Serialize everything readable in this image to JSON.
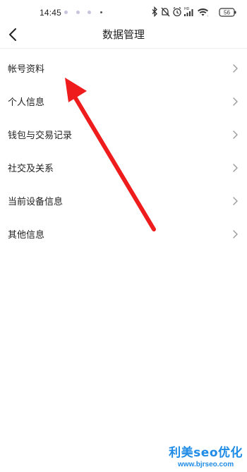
{
  "status_bar": {
    "time": "14:45",
    "battery": "56",
    "icons": [
      "bluetooth-icon",
      "mute-icon",
      "alarm-icon",
      "hd-signal-icon",
      "wifi-icon",
      "battery-icon"
    ]
  },
  "header": {
    "title": "数据管理",
    "back_icon": "chevron-left-icon"
  },
  "menu": {
    "items": [
      {
        "label": "帐号资料"
      },
      {
        "label": "个人信息"
      },
      {
        "label": "钱包与交易记录"
      },
      {
        "label": "社交及关系"
      },
      {
        "label": "当前设备信息"
      },
      {
        "label": "其他信息"
      }
    ],
    "trailing_icon": "chevron-right-icon"
  },
  "annotation": {
    "arrow_color": "#ee1c1c"
  },
  "watermark": {
    "title": "利美seo优化",
    "url": "www.bjrseo.com",
    "color": "#1e8be6"
  }
}
